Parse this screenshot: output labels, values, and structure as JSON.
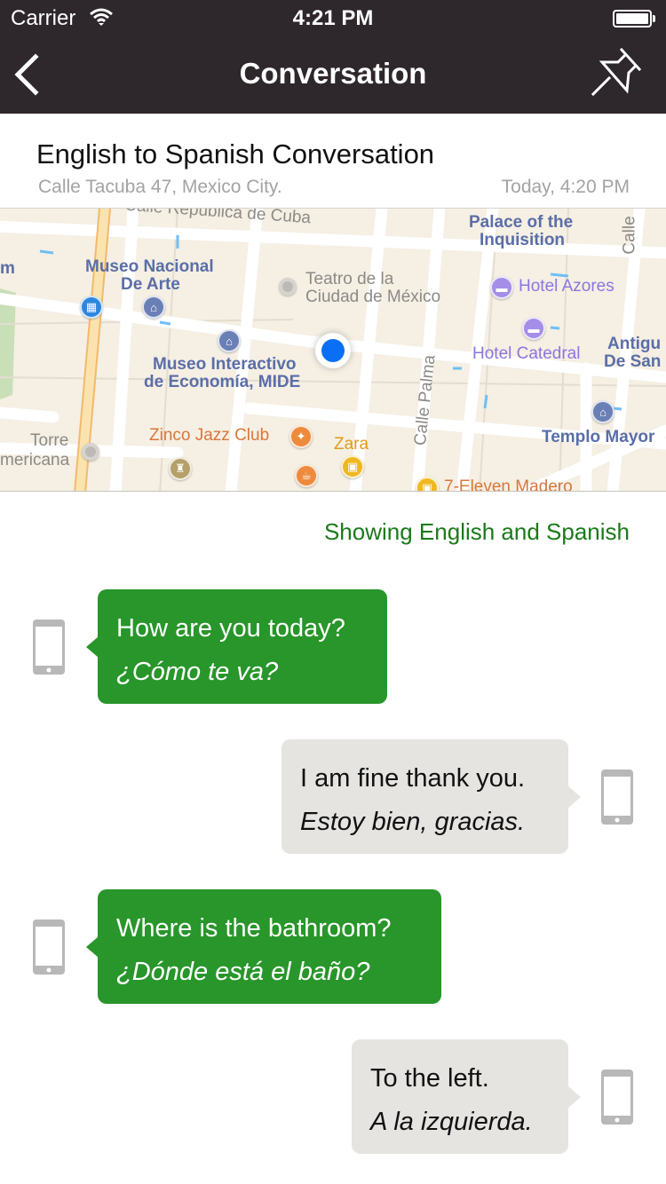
{
  "status_bar": {
    "carrier": "Carrier",
    "time": "4:21 PM"
  },
  "nav": {
    "title": "Conversation",
    "back_icon": "chevron-left-icon",
    "pin_icon": "pushpin-icon"
  },
  "conversation": {
    "title": "English to Spanish Conversation",
    "location": "Calle Tacuba 47, Mexico City.",
    "timestamp": "Today, 4:20 PM"
  },
  "map": {
    "labels": {
      "republica_cuba": "Calle República de Cuba",
      "palace": "Palace of the",
      "palace2": "Inquisition",
      "calle_top": "Calle",
      "m_edge": "m",
      "museo_nacional": "Museo Nacional",
      "museo_nacional2": "De Arte",
      "teatro": "Teatro de la",
      "teatro2": "Ciudad de México",
      "hotel_azores": "Hotel Azores",
      "hotel_catedral": "Hotel Catedral",
      "antigua": "Antigu",
      "antigua2": "De San",
      "mide": "Museo Interactivo",
      "mide2": "de Economía, MIDE",
      "calle_palma": "Calle Palma",
      "templo_mayor": "Templo Mayor",
      "zinco": "Zinco Jazz Club",
      "zara": "Zara",
      "torre": "Torre",
      "torre2": "mericana",
      "seven_eleven": "7-Eleven Madero"
    }
  },
  "language_toggle": "Showing English and Spanish",
  "colors": {
    "nav_bg": "#2e272b",
    "accent_green": "#28962a",
    "toggle_green": "#1a7a1a",
    "bubble_gray": "#e5e4e1",
    "user_location": "#0a6ff5"
  },
  "messages": [
    {
      "side": "left",
      "english": "How are you today?",
      "spanish": "¿Cómo te va?"
    },
    {
      "side": "right",
      "english": "I am fine thank you.",
      "spanish": "Estoy bien, gracias."
    },
    {
      "side": "left",
      "english": "Where is the bathroom?",
      "spanish": "¿Dónde está el baño?"
    },
    {
      "side": "right",
      "english": "To the left.",
      "spanish": "A la izquierda."
    }
  ]
}
